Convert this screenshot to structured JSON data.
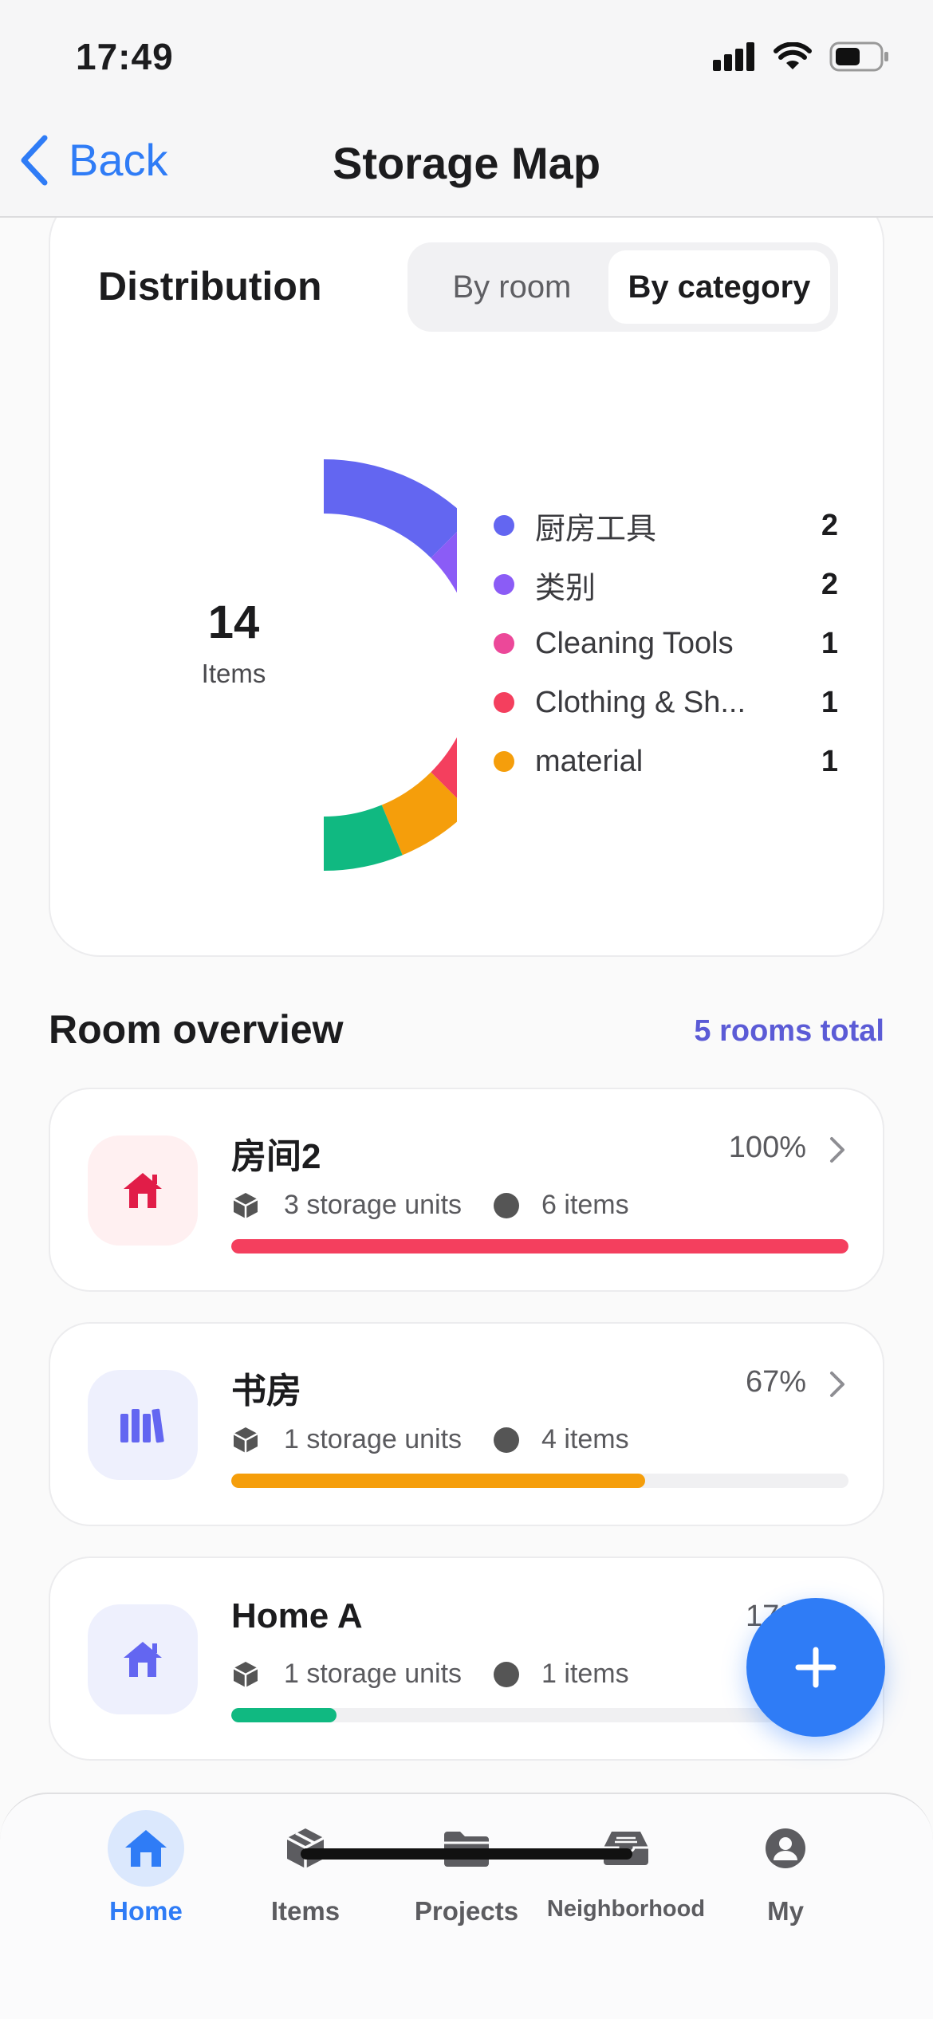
{
  "status": {
    "time": "17:49"
  },
  "nav": {
    "back_label": "Back",
    "title": "Storage Map"
  },
  "distribution": {
    "title": "Distribution",
    "toggle": {
      "options": [
        "By room",
        "By category"
      ],
      "selected": "By category"
    },
    "total": "14",
    "total_unit": "Items",
    "legend": [
      {
        "label": "厨房工具",
        "count": "2",
        "color": "#6366f1"
      },
      {
        "label": "类别",
        "count": "2",
        "color": "#8b5cf6"
      },
      {
        "label": "Cleaning Tools",
        "count": "1",
        "color": "#ec4899"
      },
      {
        "label": "Clothing & Sh...",
        "count": "1",
        "color": "#f43f5e"
      },
      {
        "label": "material",
        "count": "1",
        "color": "#f59e0b"
      }
    ]
  },
  "chart_data": {
    "type": "pie",
    "categories": [
      "厨房工具",
      "类别",
      "Cleaning Tools",
      "Clothing & Sh...",
      "material",
      "(unlabeled)"
    ],
    "values": [
      2,
      2,
      1,
      1,
      1,
      1
    ],
    "colors": [
      "#6366f1",
      "#8b5cf6",
      "#ec4899",
      "#f43f5e",
      "#f59e0b",
      "#10b981"
    ],
    "style": "half-donut"
  },
  "rooms": {
    "title": "Room overview",
    "total_label": "5 rooms total",
    "items": [
      {
        "name": "房间2",
        "percent": "100%",
        "fill": 1.0,
        "storage": "3 storage units",
        "items": "6 items",
        "color": "#f43f5e",
        "bg": "#fff0f1",
        "icon": "home-icon"
      },
      {
        "name": "书房",
        "percent": "67%",
        "fill": 0.67,
        "storage": "1 storage units",
        "items": "4 items",
        "color": "#f59e0b",
        "bg": "#eef0fd",
        "icon": "books-icon"
      },
      {
        "name": "Home A",
        "percent": "17%",
        "fill": 0.17,
        "storage": "1 storage units",
        "items": "1 items",
        "color": "#10b981",
        "bg": "#eef0fd",
        "icon": "home-icon"
      }
    ]
  },
  "tabs": [
    {
      "label": "Home",
      "icon": "home-icon",
      "active": true
    },
    {
      "label": "Items",
      "icon": "box-icon",
      "active": false
    },
    {
      "label": "Projects",
      "icon": "folder-icon",
      "active": false
    },
    {
      "label": "Neighborhood",
      "icon": "inbox-icon",
      "active": false
    },
    {
      "label": "My",
      "icon": "user-icon",
      "active": false
    }
  ]
}
